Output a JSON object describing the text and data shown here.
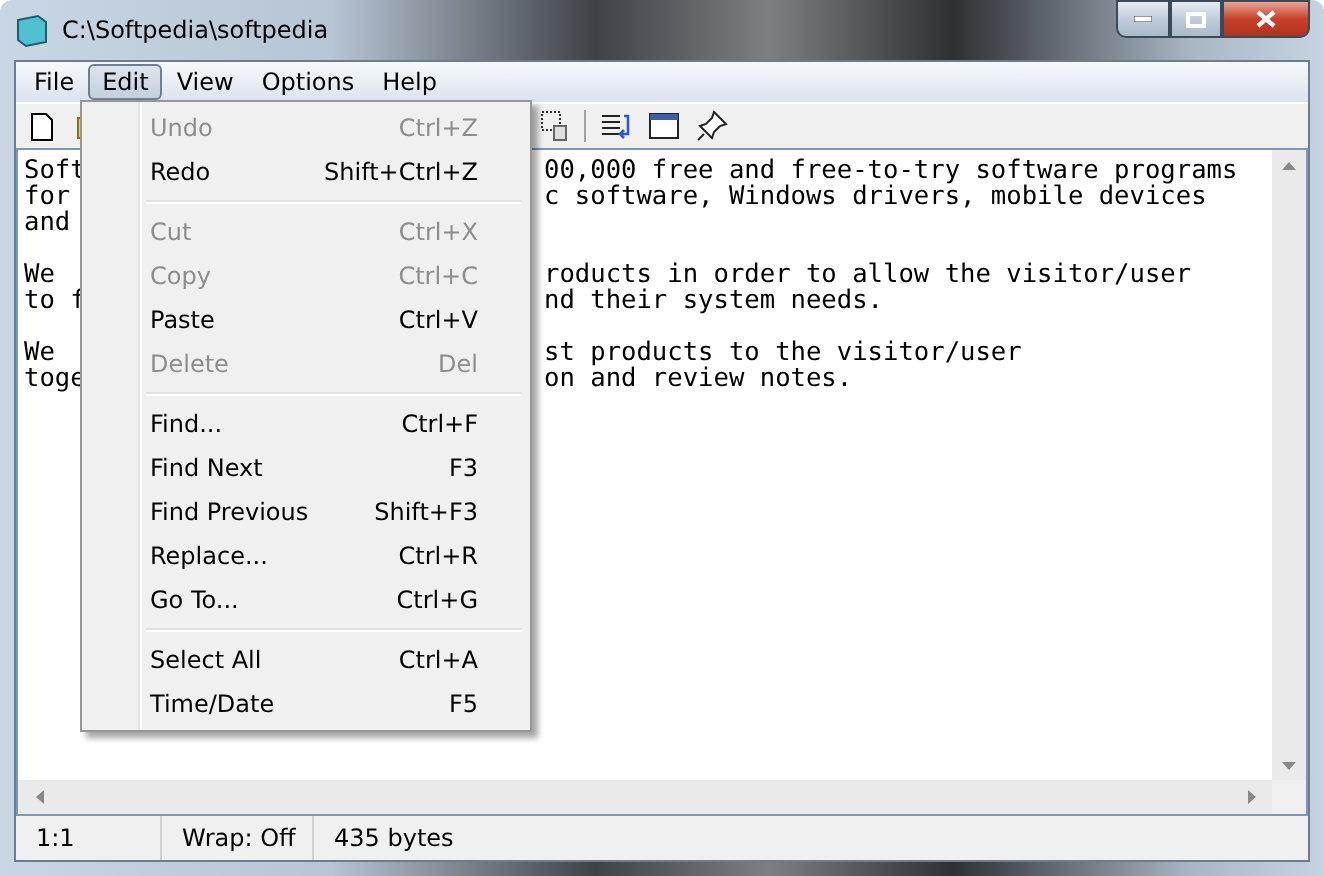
{
  "window": {
    "title": "C:\\Softpedia\\softpedia"
  },
  "menu_bar": [
    {
      "label": "File",
      "selected": false
    },
    {
      "label": "Edit",
      "selected": true
    },
    {
      "label": "View",
      "selected": false
    },
    {
      "label": "Options",
      "selected": false
    },
    {
      "label": "Help",
      "selected": false
    }
  ],
  "editor": {
    "paragraphs": [
      {
        "lines": [
          {
            "left": "Soft",
            "right": "00,000 free and free-to-try software programs"
          },
          {
            "left": "for",
            "right": "c software, Windows drivers, mobile devices"
          },
          {
            "left": "and"
          }
        ]
      },
      {
        "lines": [
          {
            "left": "We",
            "right": "roducts in order to allow the visitor/user"
          },
          {
            "left": "to f",
            "right": "nd their system needs."
          }
        ]
      },
      {
        "lines": [
          {
            "left": "We",
            "right": "st products to the visitor/user"
          },
          {
            "left": "toge",
            "right": "on and review notes."
          }
        ]
      }
    ]
  },
  "edit_menu": {
    "sections": [
      {
        "items": [
          {
            "label": "Undo",
            "shortcut": "Ctrl+Z",
            "disabled": true
          },
          {
            "label": "Redo",
            "shortcut": "Shift+Ctrl+Z",
            "disabled": false
          }
        ]
      },
      {
        "items": [
          {
            "label": "Cut",
            "shortcut": "Ctrl+X",
            "disabled": true
          },
          {
            "label": "Copy",
            "shortcut": "Ctrl+C",
            "disabled": true
          },
          {
            "label": "Paste",
            "shortcut": "Ctrl+V",
            "disabled": false
          },
          {
            "label": "Delete",
            "shortcut": "Del",
            "disabled": true
          }
        ]
      },
      {
        "items": [
          {
            "label": "Find...",
            "shortcut": "Ctrl+F",
            "disabled": false
          },
          {
            "label": "Find Next",
            "shortcut": "F3",
            "disabled": false
          },
          {
            "label": "Find Previous",
            "shortcut": "Shift+F3",
            "disabled": false
          },
          {
            "label": "Replace...",
            "shortcut": "Ctrl+R",
            "disabled": false
          },
          {
            "label": "Go To...",
            "shortcut": "Ctrl+G",
            "disabled": false
          }
        ]
      },
      {
        "items": [
          {
            "label": "Select All",
            "shortcut": "Ctrl+A",
            "disabled": false
          },
          {
            "label": "Time/Date",
            "shortcut": "F5",
            "disabled": false
          }
        ]
      }
    ]
  },
  "status_bar": [
    {
      "text": "1:1"
    },
    {
      "text": "Wrap: Off"
    },
    {
      "text": "435 bytes"
    }
  ]
}
